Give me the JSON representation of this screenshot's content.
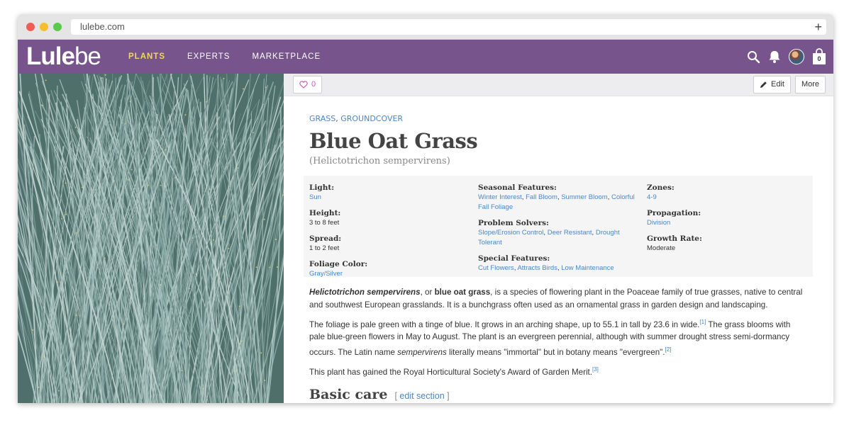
{
  "browser": {
    "url": "lulebe.com"
  },
  "nav": {
    "logo_bold": "Lule",
    "logo_light": "be",
    "links": [
      {
        "label": "PLANTS",
        "active": true
      },
      {
        "label": "EXPERTS",
        "active": false
      },
      {
        "label": "MARKETPLACE",
        "active": false
      }
    ],
    "cart_count": "0",
    "accent_color": "#77558c",
    "active_color": "#f1d75e"
  },
  "toolbar": {
    "like_count": "0",
    "edit_label": "Edit",
    "more_label": "More"
  },
  "plant": {
    "categories": [
      "GRASS",
      "GROUNDCOVER"
    ],
    "category_sep": ", ",
    "name": "Blue Oat Grass",
    "latin": "(Helictotrichon sempervirens)"
  },
  "attributes": {
    "light": {
      "label": "Light:",
      "value": "Sun"
    },
    "height": {
      "label": "Height:",
      "value": "3 to 8 feet"
    },
    "spread": {
      "label": "Spread:",
      "value": "1 to 2 feet"
    },
    "foliage_color": {
      "label": "Foliage Color:",
      "value": "Gray/Silver"
    },
    "seasonal": {
      "label": "Seasonal Features:",
      "items": [
        "Winter Interest",
        "Fall Bloom",
        "Summer Bloom",
        "Colorful Fall Foliage"
      ]
    },
    "problem": {
      "label": "Problem Solvers:",
      "items": [
        "Slope/Erosion Control",
        "Deer Resistant",
        "Drought Tolerant"
      ]
    },
    "special": {
      "label": "Special Features:",
      "items": [
        "Cut Flowers",
        "Attracts Birds",
        "Low Maintenance"
      ]
    },
    "zones": {
      "label": "Zones:",
      "value": "4-9"
    },
    "propagation": {
      "label": "Propagation:",
      "value": "Division"
    },
    "growth": {
      "label": "Growth Rate:",
      "value": "Moderate"
    }
  },
  "description": {
    "p1_em": "Helictotrichon sempervirens",
    "p1_a": ", or ",
    "p1_bold": "blue oat grass",
    "p1_b": ", is a species of flowering plant in the Poaceae family of true grasses, native to central and southwest European grasslands. It is a bunchgrass often used as an ornamental grass in garden design and landscaping.",
    "p2_a": "The foliage is pale green with a tinge of blue. It grows in an arching shape, up to 55.1 in tall by 23.6 in wide.",
    "p2_ref1": "[1]",
    "p2_b": " The grass blooms with pale blue-green flowers in May to August. The plant is an evergreen perennial, although with summer drought stress semi-dormancy occurs. The Latin name ",
    "p2_em": "sempervirens",
    "p2_c": " literally means \"immortal\" but in botany means \"evergreen\".",
    "p2_ref2": "[2]",
    "p3": "This plant has gained the Royal Horticultural Society's Award of Garden Merit.",
    "p3_ref": "[3]"
  },
  "section": {
    "title": "Basic care",
    "bracket_open": "[",
    "edit_label": "edit section",
    "bracket_close": "]"
  }
}
